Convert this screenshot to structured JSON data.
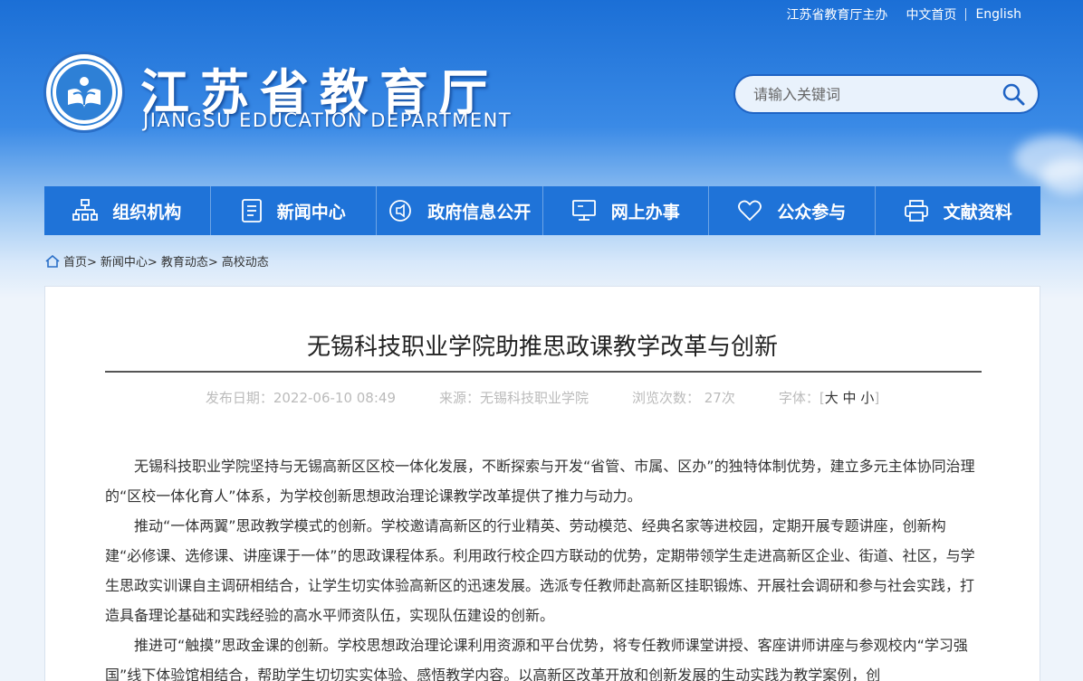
{
  "top_links": {
    "sponsor": "江苏省教育厅主办",
    "home_cn": "中文首页",
    "english": "English"
  },
  "header": {
    "title": "江苏省教育厅",
    "subtitle": "JIANGSU EDUCATION DEPARTMENT"
  },
  "search": {
    "placeholder": "请输入关键词"
  },
  "nav": {
    "items": [
      {
        "label": "组织机构",
        "icon": "org-chart-icon"
      },
      {
        "label": "新闻中心",
        "icon": "document-icon"
      },
      {
        "label": "政府信息公开",
        "icon": "speaker-icon"
      },
      {
        "label": "网上办事",
        "icon": "monitor-icon"
      },
      {
        "label": "公众参与",
        "icon": "heart-icon"
      },
      {
        "label": "文献资料",
        "icon": "printer-icon"
      }
    ]
  },
  "breadcrumb": [
    "首页>",
    "新闻中心>",
    "教育动态>",
    "高校动态"
  ],
  "article": {
    "title": "无锡科技职业学院助推思政课教学改革与创新",
    "publish_date": "发布日期：2022-06-10 08:49",
    "source": "来源：无锡科技职业学院",
    "views": "浏览次数： 27次",
    "font_label": "字体：[",
    "font_large": "大",
    "font_medium": "中",
    "font_small": "小",
    "font_end": "]",
    "paragraphs": [
      "无锡科技职业学院坚持与无锡高新区区校一体化发展，不断探索与开发“省管、市属、区办”的独特体制优势，建立多元主体协同治理的“区校一体化育人”体系，为学校创新思想政治理论课教学改革提供了推力与动力。",
      "推动“一体两翼”思政教学模式的创新。学校邀请高新区的行业精英、劳动模范、经典名家等进校园，定期开展专题讲座，创新构建“必修课、选修课、讲座课于一体”的思政课程体系。利用政行校企四方联动的优势，定期带领学生走进高新区企业、街道、社区，与学生思政实训课自主调研相结合，让学生切实体验高新区的迅速发展。选派专任教师赴高新区挂职锻炼、开展社会调研和参与社会实践，打造具备理论基础和实践经验的高水平师资队伍，实现队伍建设的创新。",
      "推进可“触摸”思政金课的创新。学校思想政治理论课利用资源和平台优势，将专任教师课堂讲授、客座讲师讲座与参观校内“学习强国”线下体验馆相结合，帮助学生切切实实体验、感悟教学内容。以高新区改革开放和创新发展的生动实践为教学案例，创"
    ]
  }
}
